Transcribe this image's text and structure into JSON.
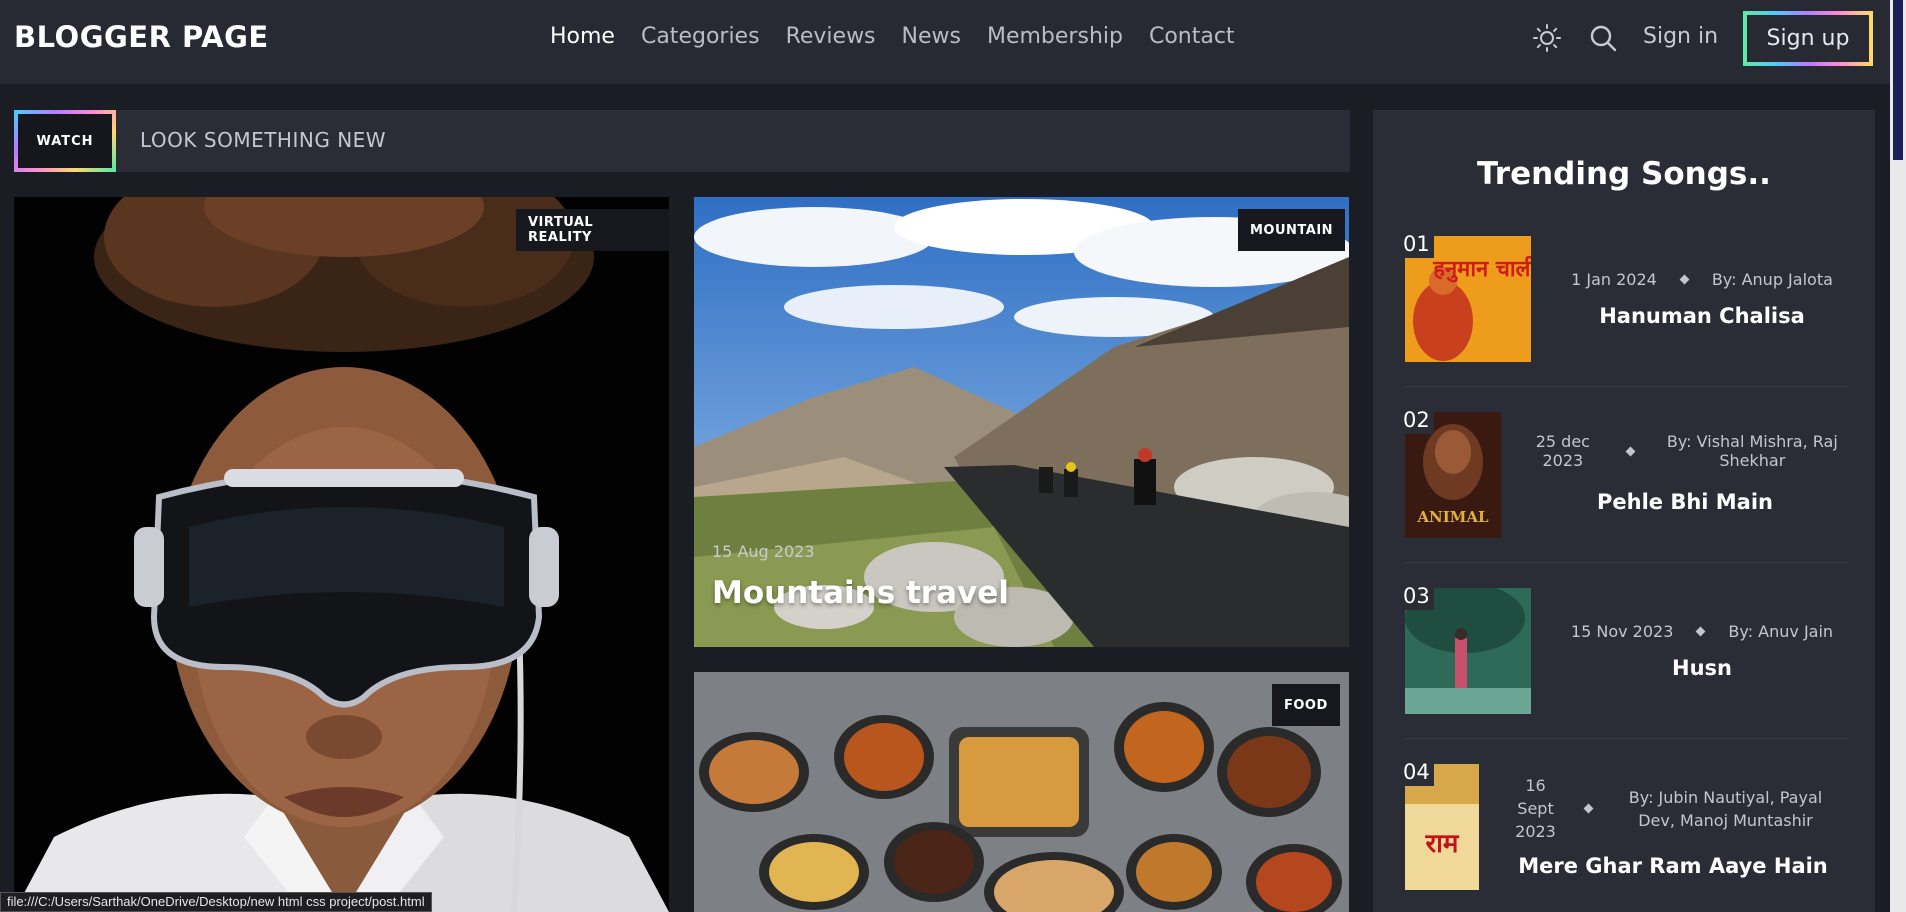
{
  "header": {
    "logo": "BLOGGER PAGE",
    "nav": [
      "Home",
      "Categories",
      "Reviews",
      "News",
      "Membership",
      "Contact"
    ],
    "active_nav": "Home",
    "icons": [
      "sun-icon",
      "search-icon"
    ],
    "signin": "Sign in",
    "signup": "Sign up"
  },
  "ticker": {
    "badge": "WATCH",
    "text": "LOOK SOMETHING NEW"
  },
  "cards": {
    "vr": {
      "tag": "VIRTUAL REALITY"
    },
    "mountain": {
      "tag": "MOUNTAIN",
      "date": "15 Aug 2023",
      "title": "Mountains travel"
    },
    "food": {
      "tag": "FOOD"
    }
  },
  "trending": {
    "title": "Trending Songs..",
    "songs": [
      {
        "num": "01",
        "date": "1 Jan 2024",
        "by": "By: Anup Jalota",
        "title": "Hanuman Chalisa",
        "poster_text": "हनुमान चालीसा"
      },
      {
        "num": "02",
        "date": "25 dec 2023",
        "by": "By: Vishal Mishra, Raj Shekhar",
        "title": "Pehle Bhi Main",
        "poster_text": "ANIMAL"
      },
      {
        "num": "03",
        "date": "15 Nov 2023",
        "by": "By: Anuv Jain",
        "title": "Husn",
        "poster_text": ""
      },
      {
        "num": "04",
        "date": "16 Sept 2023",
        "by": "By: Jubin Nautiyal, Payal Dev, Manoj Muntashir",
        "title": "Mere Ghar Ram Aaye Hain",
        "poster_text": "राम"
      }
    ]
  },
  "statusbar": "file:///C:/Users/Sarthak/OneDrive/Desktop/new html css project/post.html",
  "colors": {
    "bg": "#1b1d24",
    "panel": "#2a2d36",
    "header": "#272a33",
    "tag_bg": "#17181d"
  }
}
